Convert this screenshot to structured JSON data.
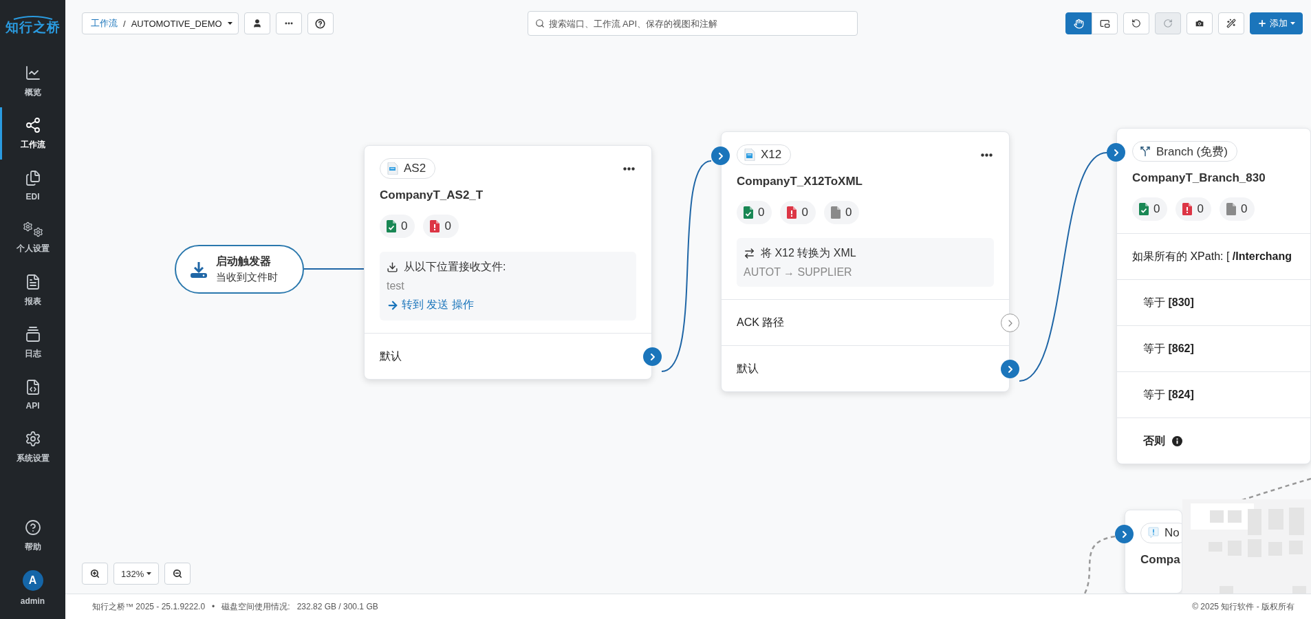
{
  "brand": {
    "logo": "知行之桥"
  },
  "sidebar": {
    "items": [
      {
        "kind": "overview",
        "label": "概览",
        "selected": false
      },
      {
        "kind": "workflows",
        "label": "工作流",
        "selected": true
      },
      {
        "kind": "edi",
        "label": "EDI",
        "selected": false
      },
      {
        "kind": "profile",
        "label": "个人设置",
        "selected": false
      },
      {
        "kind": "reports",
        "label": "报表",
        "selected": false
      },
      {
        "kind": "logs",
        "label": "日志",
        "selected": false
      },
      {
        "kind": "api",
        "label": "API",
        "selected": false
      },
      {
        "kind": "settings",
        "label": "系统设置",
        "selected": false
      }
    ],
    "help": {
      "label": "帮助"
    },
    "user": {
      "initial": "A",
      "name": "admin"
    }
  },
  "toolbar": {
    "breadcrumb": {
      "link": "工作流",
      "separator": "/",
      "current": "AUTOMOTIVE_DEMO"
    },
    "search": {
      "placeholder": "搜索端口、工作流 API、保存的视图和注解"
    },
    "view_modes": [
      {
        "kind": "pan",
        "selected": true
      },
      {
        "kind": "frame",
        "selected": false
      }
    ],
    "history": [
      {
        "kind": "undo",
        "disabled": false
      },
      {
        "kind": "redo",
        "disabled": true
      }
    ],
    "add_button": "添加"
  },
  "trigger": {
    "title": "启动触发器",
    "subtitle": "当收到文件时"
  },
  "nodes": [
    {
      "kind": "as2",
      "badge": "AS2",
      "title": "CompanyT_AS2_T",
      "input": false,
      "counts": [
        {
          "kind": "success",
          "value": "0"
        },
        {
          "kind": "error",
          "value": "0"
        }
      ],
      "info": {
        "kind": "receive",
        "heading": "从以下位置接收文件:",
        "detail": "test",
        "link": "转到 发送 操作"
      },
      "outputs": [
        {
          "label": "默认",
          "connected": true
        }
      ]
    },
    {
      "kind": "x12",
      "badge": "X12",
      "title": "CompanyT_X12ToXML",
      "input": true,
      "counts": [
        {
          "kind": "success",
          "value": "0"
        },
        {
          "kind": "error",
          "value": "0"
        },
        {
          "kind": "pending",
          "value": "0"
        }
      ],
      "info": {
        "kind": "convert",
        "heading": "将 X12 转换为 XML",
        "detail": "AUTOT → SUPPLIER"
      },
      "outputs": [
        {
          "label": "ACK 路径",
          "connected": false
        },
        {
          "label": "默认",
          "connected": true
        }
      ]
    },
    {
      "kind": "branch",
      "badge": "Branch (免费)",
      "title": "CompanyT_Branch_830",
      "input": true,
      "counts": [
        {
          "kind": "success",
          "value": "0"
        },
        {
          "kind": "error",
          "value": "0"
        },
        {
          "kind": "pending",
          "value": "0"
        }
      ],
      "condition": "如果所有的 XPath: [ **/Interchang**",
      "cases": [
        "等于 **[830]**",
        "等于 **[862]**",
        "等于 **[824]**"
      ],
      "otherwise": "否则"
    },
    {
      "kind": "notify",
      "badge": "No",
      "title": "Compa",
      "input": true
    }
  ],
  "zoom": {
    "level": "132%"
  },
  "footer": {
    "version": "知行之桥™ 2025 - 25.1.9222.0",
    "separator": "•",
    "disk_label": "磁盘空间使用情况:",
    "disk_value": "232.82 GB / 300.1 GB",
    "copyright": "© 2025 知行软件 - 版权所有"
  }
}
